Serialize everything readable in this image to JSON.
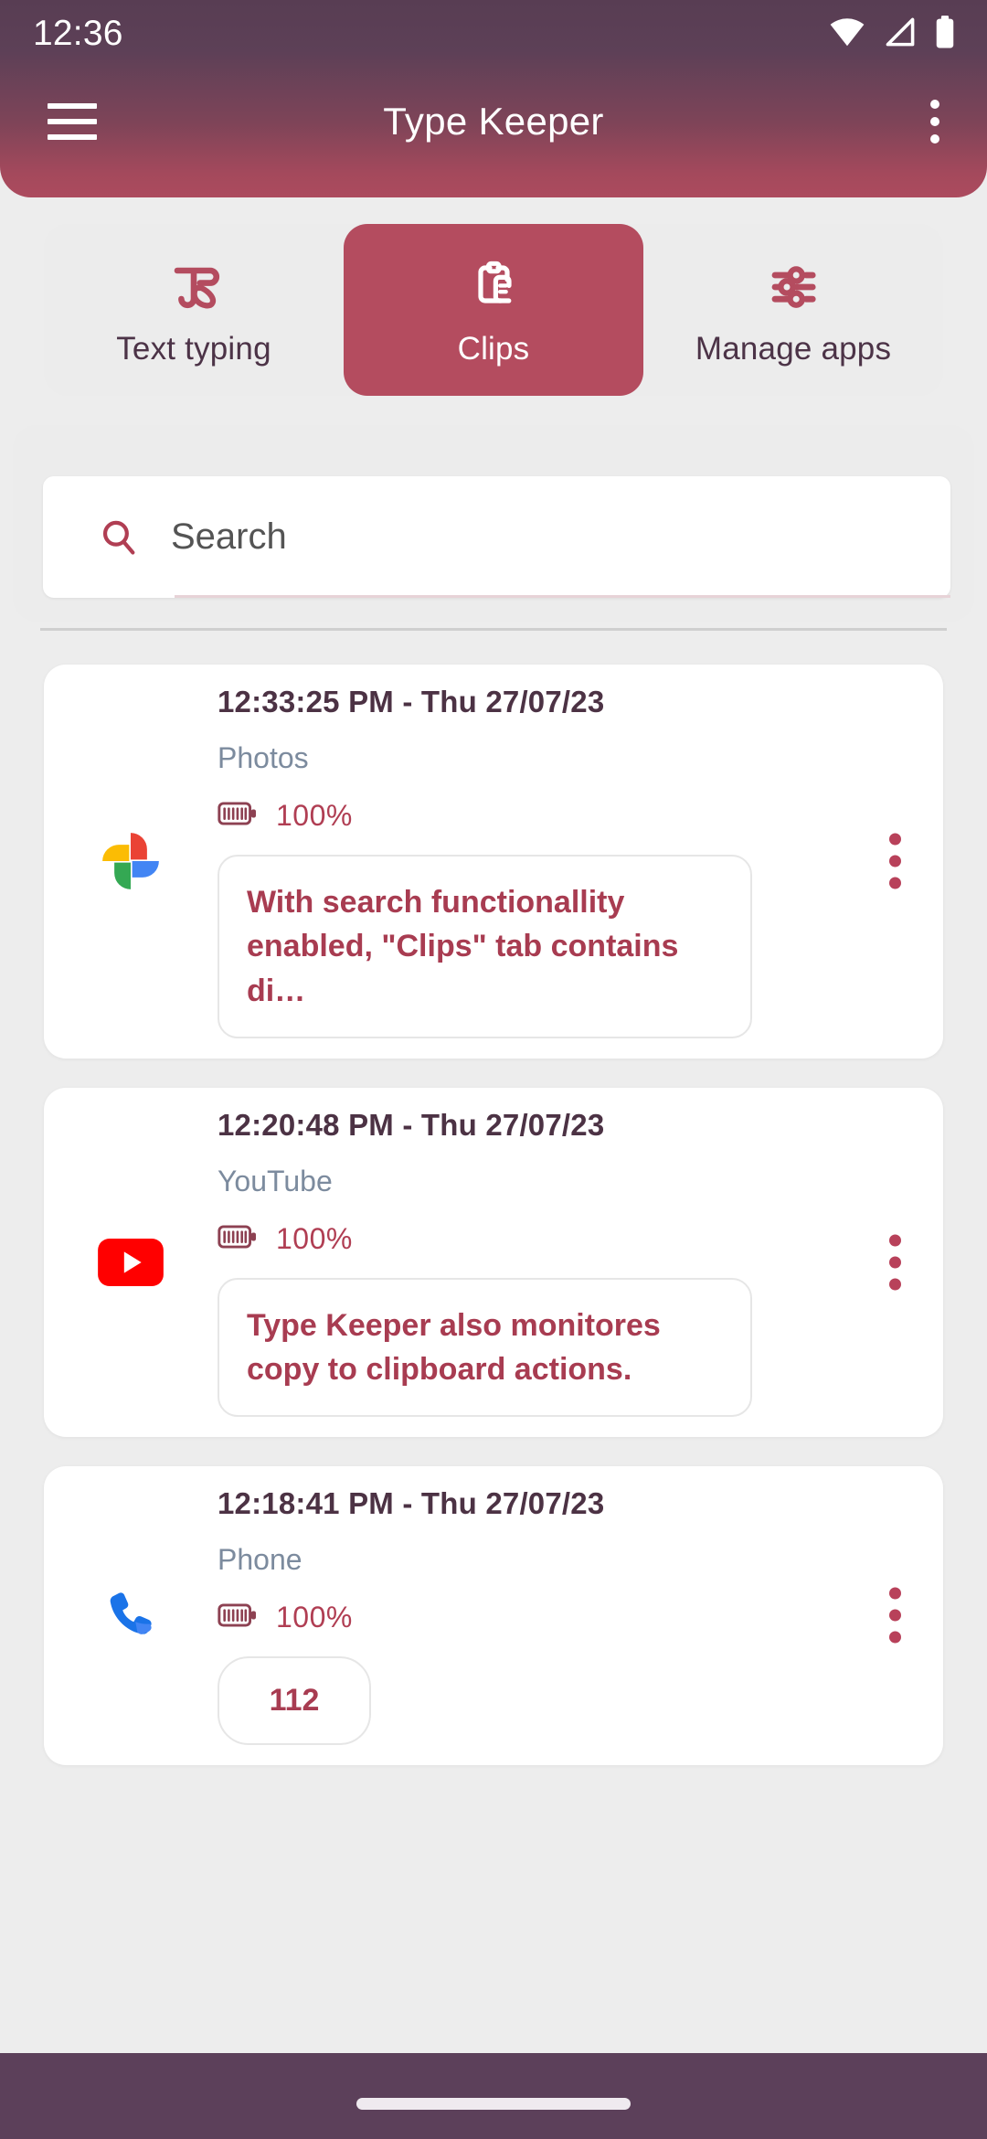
{
  "status_bar": {
    "time": "12:36",
    "icons": [
      "wifi-icon",
      "cell-signal-icon",
      "battery-icon"
    ]
  },
  "app_bar": {
    "title": "Type Keeper",
    "menu_icon": "hamburger-menu-icon",
    "overflow_icon": "overflow-menu-icon"
  },
  "tabs": [
    {
      "label": "Text typing",
      "icon": "text-typing-icon",
      "active": false
    },
    {
      "label": "Clips",
      "icon": "clipboard-icon",
      "active": true
    },
    {
      "label": "Manage apps",
      "icon": "sliders-icon",
      "active": false
    }
  ],
  "search": {
    "placeholder": "Search",
    "value": "",
    "icon": "search-icon"
  },
  "clips": [
    {
      "timestamp": "12:33:25 PM - Thu 27/07/23",
      "app_name": "Photos",
      "app_icon": "google-photos-icon",
      "battery": "100%",
      "content": "With search functionallity enabled, \"Clips\" tab contains di…"
    },
    {
      "timestamp": "12:20:48 PM - Thu 27/07/23",
      "app_name": "YouTube",
      "app_icon": "youtube-icon",
      "battery": "100%",
      "content": "Type Keeper also monitores copy to clipboard actions."
    },
    {
      "timestamp": "12:18:41 PM - Thu 27/07/23",
      "app_name": "Phone",
      "app_icon": "phone-icon",
      "battery": "100%",
      "content": "112"
    }
  ],
  "colors": {
    "accent": "#b44c5f",
    "appbar_top": "#583d53",
    "appbar_bottom": "#ac4b5e",
    "background": "#ededed",
    "clip_text": "#a83c51",
    "app_name_text": "#7c8b9e",
    "nav_bar": "#5c405a"
  }
}
